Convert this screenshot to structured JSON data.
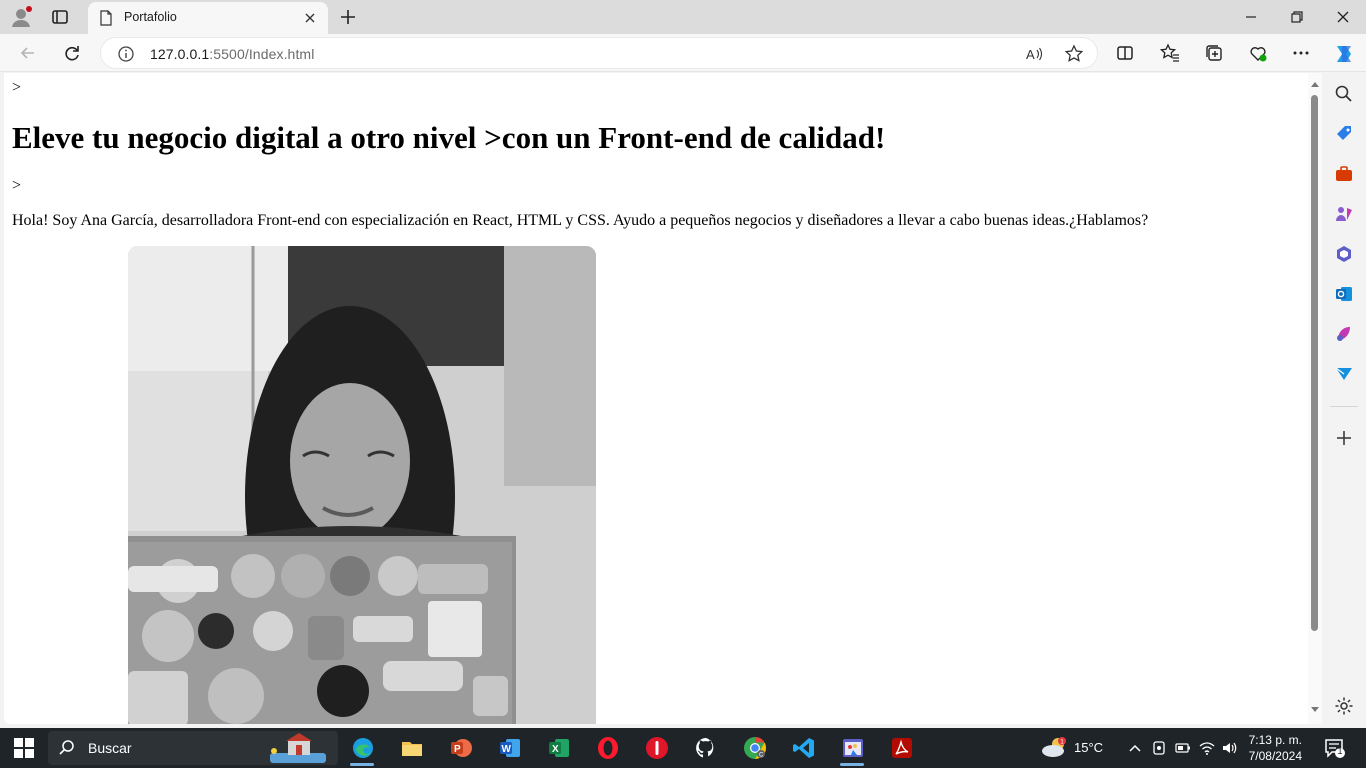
{
  "browser": {
    "tab_title": "Portafolio",
    "url_host": "127.0.0.1",
    "url_path": ":5500/Index.html"
  },
  "page": {
    "stray_top": ">",
    "hero_title": "Eleve tu negocio digital a otro nivel >con un Front-end de calidad!",
    "stray_mid": ">",
    "intro": "Hola! Soy Ana García, desarrolladora Front-end con especialización en React, HTML y CSS. Ayudo a pequeños negocios y diseñadores a llevar a cabo buenas ideas.¿Hablamos?",
    "photo_icon": "portrait-photo"
  },
  "taskbar": {
    "search_placeholder": "Buscar",
    "temperature": "15°C",
    "time": "7:13 p. m.",
    "date": "7/08/2024",
    "notification_count": "1"
  },
  "colors": {
    "tabbar": "#dcdcdc",
    "toolbar": "#f7f7f7",
    "taskbar": "#1f2428",
    "accent": "#0078d4"
  }
}
